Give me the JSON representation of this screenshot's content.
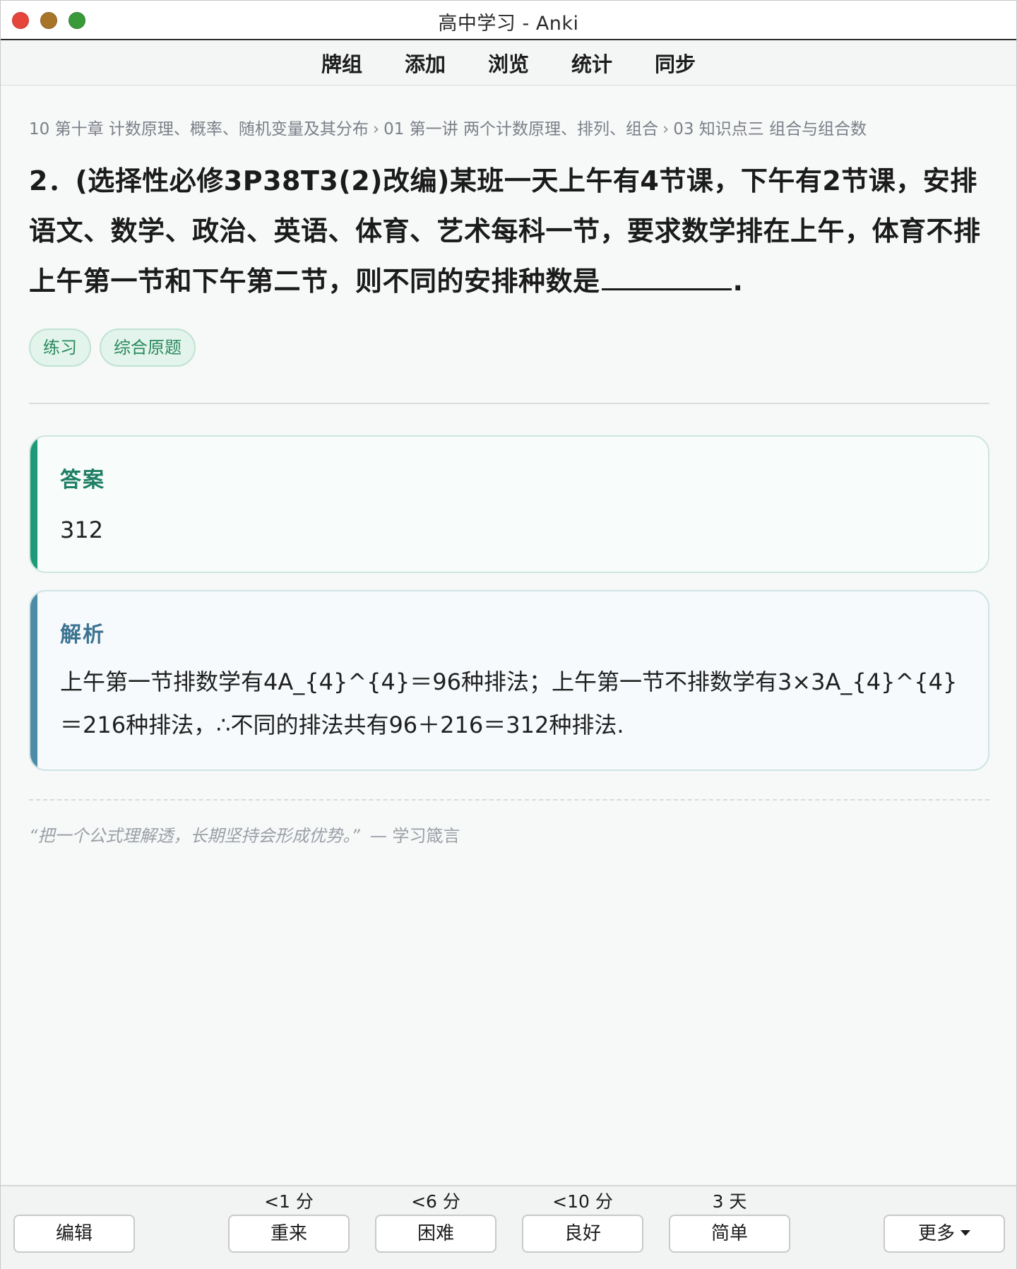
{
  "window": {
    "title": "高中学习 - Anki"
  },
  "toolbar": {
    "items": [
      "牌组",
      "添加",
      "浏览",
      "统计",
      "同步"
    ]
  },
  "breadcrumb": {
    "parts": [
      "10 第十章 计数原理、概率、随机变量及其分布",
      "01 第一讲 两个计数原理、排列、组合",
      "03 知识点三 组合与组合数"
    ],
    "separator": "›"
  },
  "question": {
    "text_before_blank": "2．(选择性必修3P38T3(2)改编)某班一天上午有4节课，下午有2节课，安排语文、数学、政治、英语、体育、艺术每科一节，要求数学排在上午，体育不排上午第一节和下午第二节，则不同的安排种数是",
    "text_after_blank": "."
  },
  "tags": [
    "练习",
    "综合原题"
  ],
  "answer": {
    "title": "答案",
    "value": "312"
  },
  "analysis": {
    "title": "解析",
    "text": "上午第一节排数学有4A_{4}^{4}＝96种排法；上午第一节不排数学有3×3A_{4}^{4}＝216种排法，∴不同的排法共有96＋216＝312种排法."
  },
  "motto": {
    "quote": "“把一个公式理解透，长期坚持会形成优势。”",
    "source": "— 学习箴言"
  },
  "bottom": {
    "edit_label": "编辑",
    "more_label": "更多",
    "answers": [
      {
        "interval": "<1 分",
        "label": "重来"
      },
      {
        "interval": "<6 分",
        "label": "困难"
      },
      {
        "interval": "<10 分",
        "label": "良好"
      },
      {
        "interval": "3 天",
        "label": "简单"
      }
    ]
  },
  "colors": {
    "answer_accent": "#1f9a78",
    "analysis_accent": "#4d8ca6",
    "tag_text": "#2a8a5e",
    "traffic_close": "#e6453c",
    "traffic_min": "#a8742a",
    "traffic_max": "#3a9a3a"
  }
}
